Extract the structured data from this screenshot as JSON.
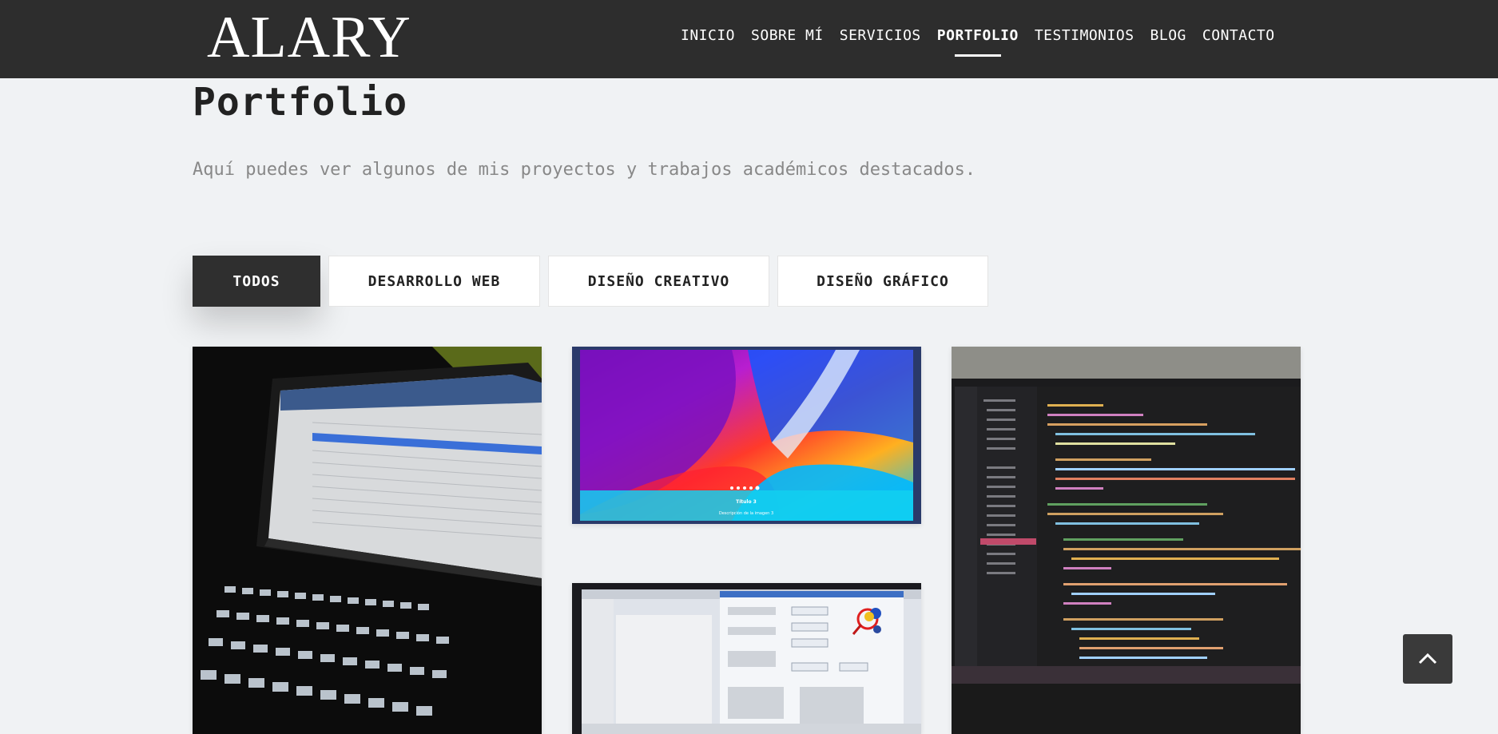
{
  "brand": {
    "logo": "ALARY"
  },
  "nav": {
    "items": [
      {
        "label": "INICIO",
        "active": false
      },
      {
        "label": "SOBRE MÍ",
        "active": false
      },
      {
        "label": "SERVICIOS",
        "active": false
      },
      {
        "label": "PORTFOLIO",
        "active": true
      },
      {
        "label": "TESTIMONIOS",
        "active": false
      },
      {
        "label": "BLOG",
        "active": false
      },
      {
        "label": "CONTACTO",
        "active": false
      }
    ]
  },
  "page": {
    "title": "Portfolio",
    "subtitle": "Aquí puedes ver algunos de mis proyectos y trabajos académicos destacados."
  },
  "filters": [
    {
      "label": "TODOS",
      "active": true
    },
    {
      "label": "DESARROLLO WEB",
      "active": false
    },
    {
      "label": "DISEÑO CREATIVO",
      "active": false
    },
    {
      "label": "DISEÑO GRÁFICO",
      "active": false
    }
  ],
  "portfolio": {
    "items": [
      {
        "image": "laptop-keyboard-photo"
      },
      {
        "image": "colorful-swirl-carousel-screenshot",
        "caption_title": "Título 3",
        "caption_text": "Descripción de la imagen 3"
      },
      {
        "image": "code-editor-laptop-photo"
      },
      {
        "image": "desktop-form-app-photo"
      }
    ]
  },
  "colors": {
    "navbar": "#2d2d2d",
    "page_bg": "#f0f2f4",
    "active_filter": "#2f2f2f"
  },
  "icons": {
    "back_to_top": "chevron-up-icon"
  }
}
